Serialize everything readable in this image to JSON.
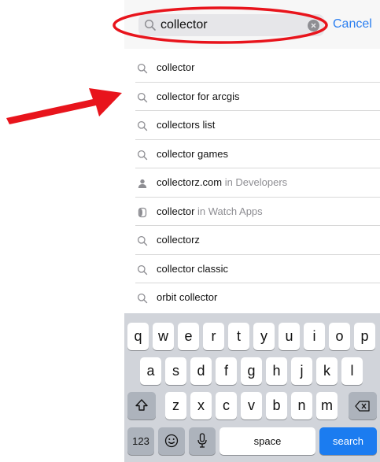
{
  "search": {
    "query": "collector",
    "cancel_label": "Cancel"
  },
  "suggestions": [
    {
      "text": "collector",
      "sub": "",
      "icon": "search-icon"
    },
    {
      "text": "collector for arcgis",
      "sub": "",
      "icon": "search-icon"
    },
    {
      "text": "collectors list",
      "sub": "",
      "icon": "search-icon"
    },
    {
      "text": "collector games",
      "sub": "",
      "icon": "search-icon"
    },
    {
      "text": "collectorz.com",
      "sub": " in Developers",
      "icon": "person-icon"
    },
    {
      "text": "collector",
      "sub": " in Watch Apps",
      "icon": "watch-icon"
    },
    {
      "text": "collectorz",
      "sub": "",
      "icon": "search-icon"
    },
    {
      "text": "collector classic",
      "sub": "",
      "icon": "search-icon"
    },
    {
      "text": "orbit collector",
      "sub": "",
      "icon": "search-icon"
    }
  ],
  "keyboard": {
    "row1": [
      "q",
      "w",
      "e",
      "r",
      "t",
      "y",
      "u",
      "i",
      "o",
      "p"
    ],
    "row2": [
      "a",
      "s",
      "d",
      "f",
      "g",
      "h",
      "j",
      "k",
      "l"
    ],
    "row3": [
      "z",
      "x",
      "c",
      "v",
      "b",
      "n",
      "m"
    ],
    "numbers_label": "123",
    "space_label": "space",
    "search_label": "search"
  },
  "colors": {
    "accent": "#2a7ef0",
    "annotation": "#e8141c",
    "search_key": "#1b7cf0"
  }
}
